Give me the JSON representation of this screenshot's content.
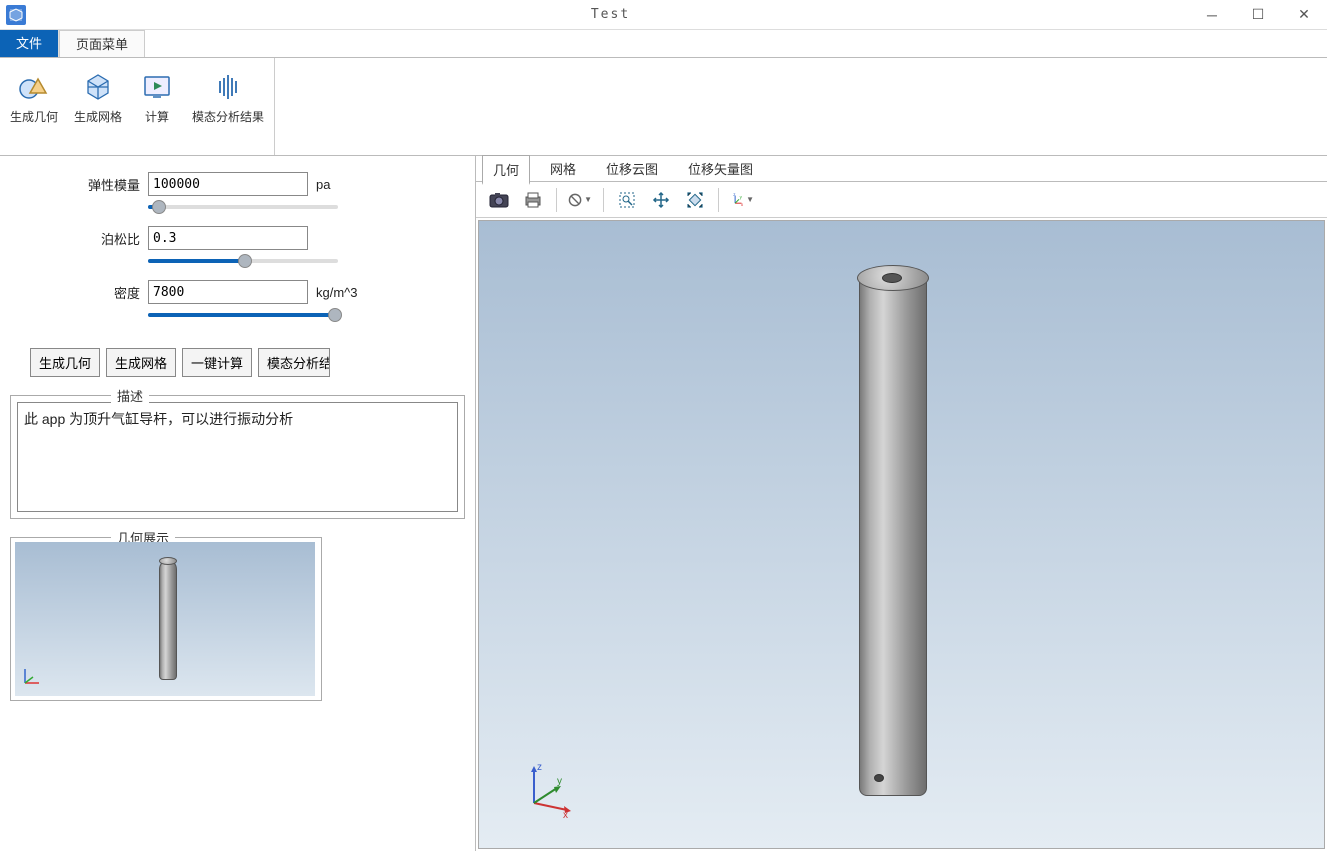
{
  "window": {
    "title": "Test"
  },
  "menu": {
    "tab_file": "文件",
    "tab_page": "页面菜单"
  },
  "ribbon": {
    "gen_geom": "生成几何",
    "gen_mesh": "生成网格",
    "calc": "计算",
    "modal_result": "模态分析结果"
  },
  "params": {
    "elastic_label": "弹性模量",
    "elastic_value": "100000",
    "elastic_unit": "pa",
    "poisson_label": "泊松比",
    "poisson_value": "0.3",
    "density_label": "密度",
    "density_value": "7800",
    "density_unit": "kg/m^3"
  },
  "buttons": {
    "gen_geom": "生成几何",
    "gen_mesh": "生成网格",
    "one_calc": "一键计算",
    "modal_result": "模态分析结果"
  },
  "desc": {
    "legend": "描述",
    "text": "此 app 为顶升气缸导杆，可以进行振动分析"
  },
  "preview": {
    "legend": "几何展示"
  },
  "viewer_tabs": {
    "geom": "几何",
    "mesh": "网格",
    "disp_cloud": "位移云图",
    "disp_vec": "位移矢量图"
  },
  "axis": {
    "x": "x",
    "y": "y",
    "z": "z"
  }
}
